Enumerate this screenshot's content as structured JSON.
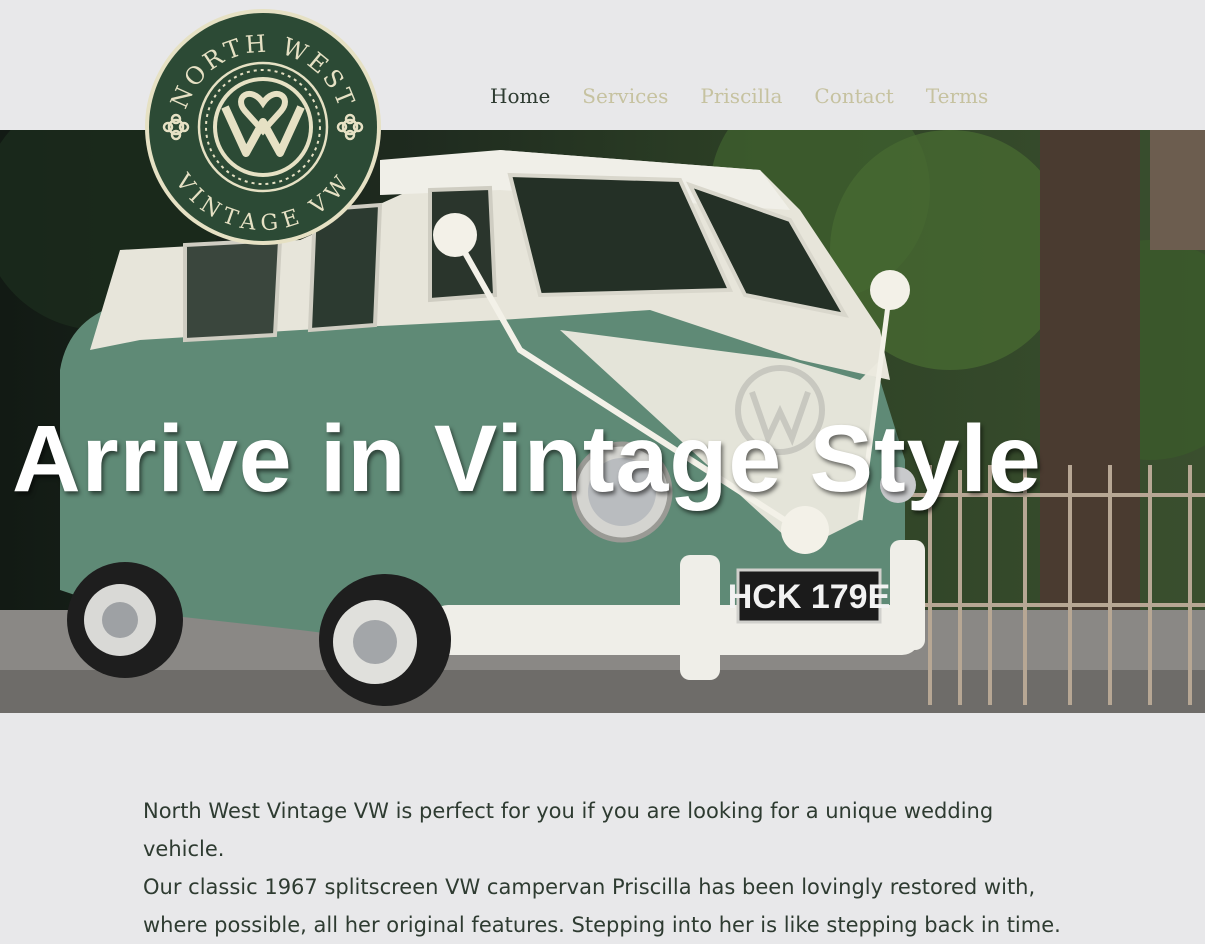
{
  "brand": {
    "logo_top_text": "NORTH WEST",
    "logo_bottom_text": "VINTAGE VW",
    "colors": {
      "logo_green": "#2c4a35",
      "logo_cream": "#e6e1c4"
    }
  },
  "nav": {
    "items": [
      {
        "label": "Home",
        "active": true
      },
      {
        "label": "Services",
        "active": false
      },
      {
        "label": "Priscilla",
        "active": false
      },
      {
        "label": "Contact",
        "active": false
      },
      {
        "label": "Terms",
        "active": false
      }
    ],
    "colors": {
      "active": "#2e3b31",
      "inactive": "#c6c2a0"
    }
  },
  "hero": {
    "title": "Arrive in Vintage Style",
    "number_plate": "HCK 179E"
  },
  "intro": {
    "lines": [
      "North West Vintage VW is perfect for you if you are looking for a unique wedding vehicle.",
      "Our classic 1967 splitscreen VW campervan Priscilla has been lovingly restored with,",
      "where possible, all her original features. Stepping into her is like stepping back in time."
    ]
  }
}
